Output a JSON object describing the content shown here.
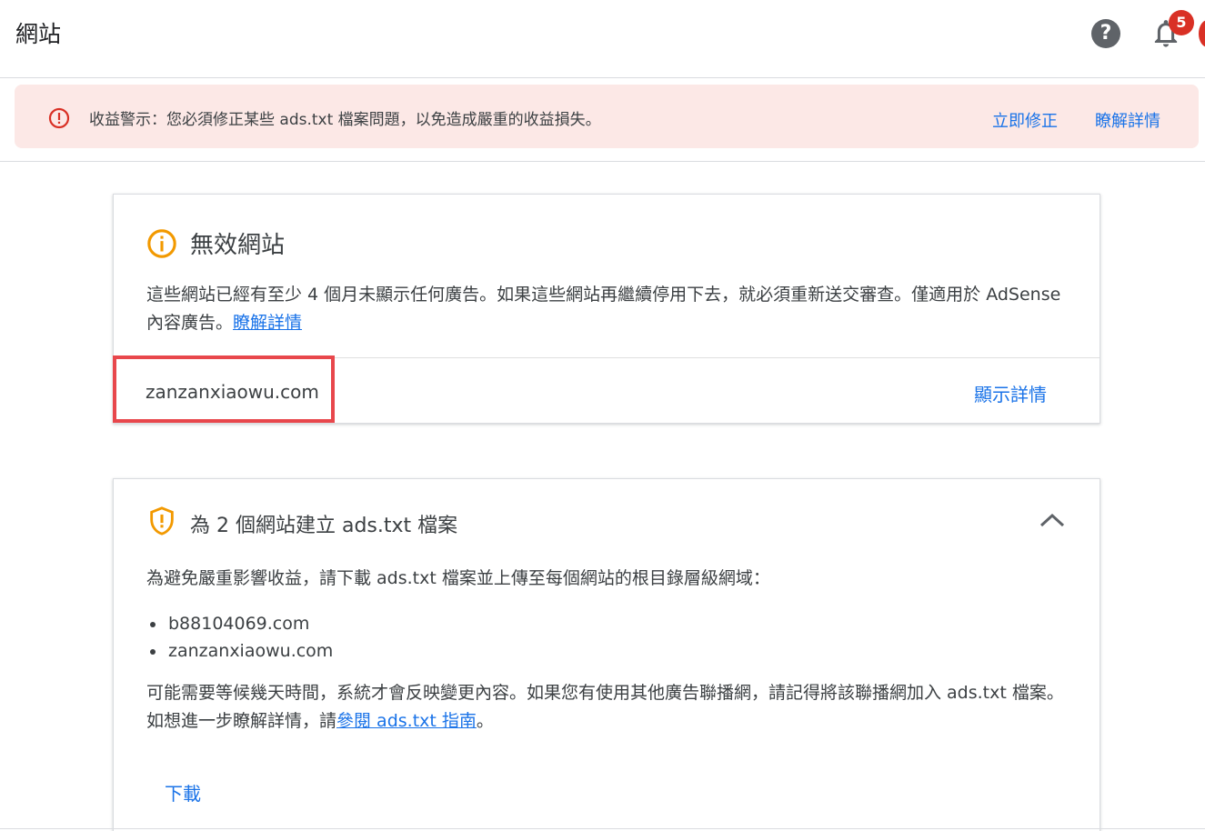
{
  "header": {
    "title": "網站",
    "help_icon": "help-icon",
    "notification_icon": "bell-icon",
    "notification_count": "5"
  },
  "alert": {
    "icon": "error-icon",
    "text": "收益警示：您必須修正某些 ads.txt 檔案問題，以免造成嚴重的收益損失。",
    "fix_label": "立即修正",
    "learn_label": "瞭解詳情",
    "color": "#fce8e6"
  },
  "invalid_sites": {
    "icon": "info-icon",
    "title": "無效網站",
    "description": "這些網站已經有至少 4 個月未顯示任何廣告。如果這些網站再繼續停用下去，就必須重新送交審查。僅適用於 AdSense 內容廣告。",
    "learn_link": "瞭解詳情",
    "site": "zanzanxiaowu.com",
    "show_details": "顯示詳情"
  },
  "ads_txt": {
    "icon": "shield-warning-icon",
    "title": "為 2 個網站建立 ads.txt 檔案",
    "description": "為避免嚴重影響收益，請下載 ads.txt 檔案並上傳至每個網站的根目錄層級網域：",
    "sites": [
      "b88104069.com",
      "zanzanxiaowu.com"
    ],
    "note_prefix": "可能需要等候幾天時間，系統才會反映變更內容。如果您有使用其他廣告聯播網，請記得將該聯播網加入 ads.txt 檔案。如想進一步瞭解詳情，請",
    "guide_link": "參閱 ads.txt 指南",
    "note_suffix": "。",
    "download_label": "下載"
  },
  "colors": {
    "accent": "#1a73e8",
    "warning": "#f29900",
    "error": "#d93025",
    "highlight": "#e8474c"
  }
}
